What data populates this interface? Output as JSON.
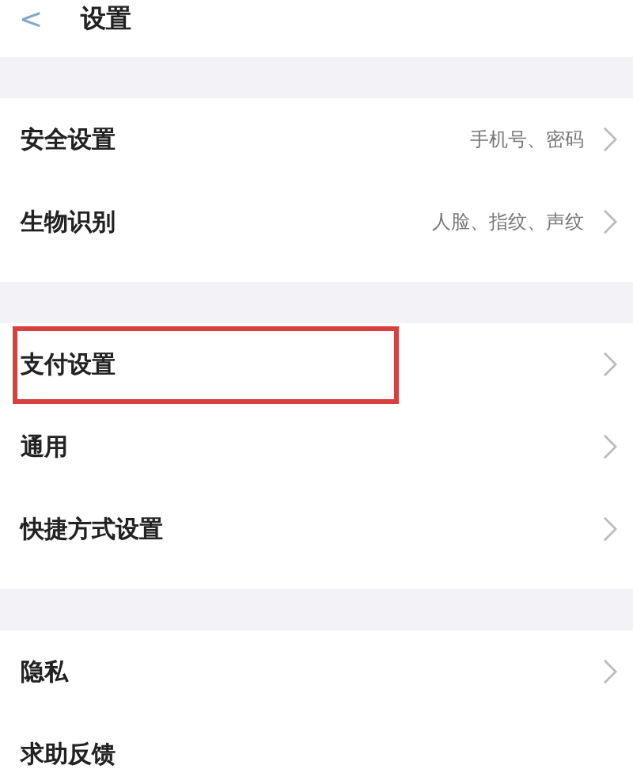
{
  "header": {
    "back": "<",
    "title": "设置"
  },
  "groups": [
    {
      "rows": [
        {
          "label": "安全设置",
          "value": "手机号、密码",
          "chevron": true,
          "highlighted": false
        },
        {
          "label": "生物识别",
          "value": "人脸、指纹、声纹",
          "chevron": true,
          "highlighted": false
        }
      ]
    },
    {
      "rows": [
        {
          "label": "支付设置",
          "chevron": true,
          "highlighted": true
        },
        {
          "label": "通用",
          "chevron": true,
          "highlighted": false
        },
        {
          "label": "快捷方式设置",
          "chevron": true,
          "highlighted": false
        }
      ]
    },
    {
      "rows": [
        {
          "label": "隐私",
          "chevron": true,
          "highlighted": false
        },
        {
          "label": "求助反馈",
          "chevron": false,
          "highlighted": false
        }
      ]
    }
  ]
}
